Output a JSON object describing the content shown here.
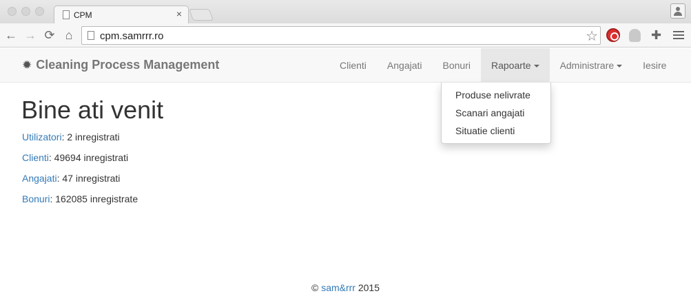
{
  "browser": {
    "tab_title": "CPM",
    "tab_close": "×",
    "url": "cpm.samrrr.ro",
    "back": "←",
    "forward": "→",
    "reload": "⟳",
    "home": "⌂",
    "star": "☆",
    "puzzle": "✚"
  },
  "navbar": {
    "brand_icon": "✹",
    "brand": "Cleaning Process Management",
    "items": [
      {
        "label": "Clienti"
      },
      {
        "label": "Angajati"
      },
      {
        "label": "Bonuri"
      },
      {
        "label": "Rapoarte"
      },
      {
        "label": "Administrare"
      },
      {
        "label": "Iesire"
      }
    ]
  },
  "dropdown": {
    "items": [
      {
        "label": "Produse nelivrate"
      },
      {
        "label": "Scanari angajati"
      },
      {
        "label": "Situatie clienti"
      }
    ]
  },
  "main": {
    "title": "Bine ati venit",
    "stats": [
      {
        "link": "Utilizatori",
        "text": ": 2 inregistrati"
      },
      {
        "link": "Clienti",
        "text": ": 49694 inregistrati"
      },
      {
        "link": "Angajati",
        "text": ": 47 inregistrati"
      },
      {
        "link": "Bonuri",
        "text": ": 162085 inregistrate"
      }
    ]
  },
  "footer": {
    "copyright": "©",
    "link": "sam&rrr",
    "year": "2015"
  },
  "colors": {
    "link": "#337ab7",
    "navbar_bg": "#f8f8f8",
    "nav_active_bg": "#e7e7e7"
  }
}
